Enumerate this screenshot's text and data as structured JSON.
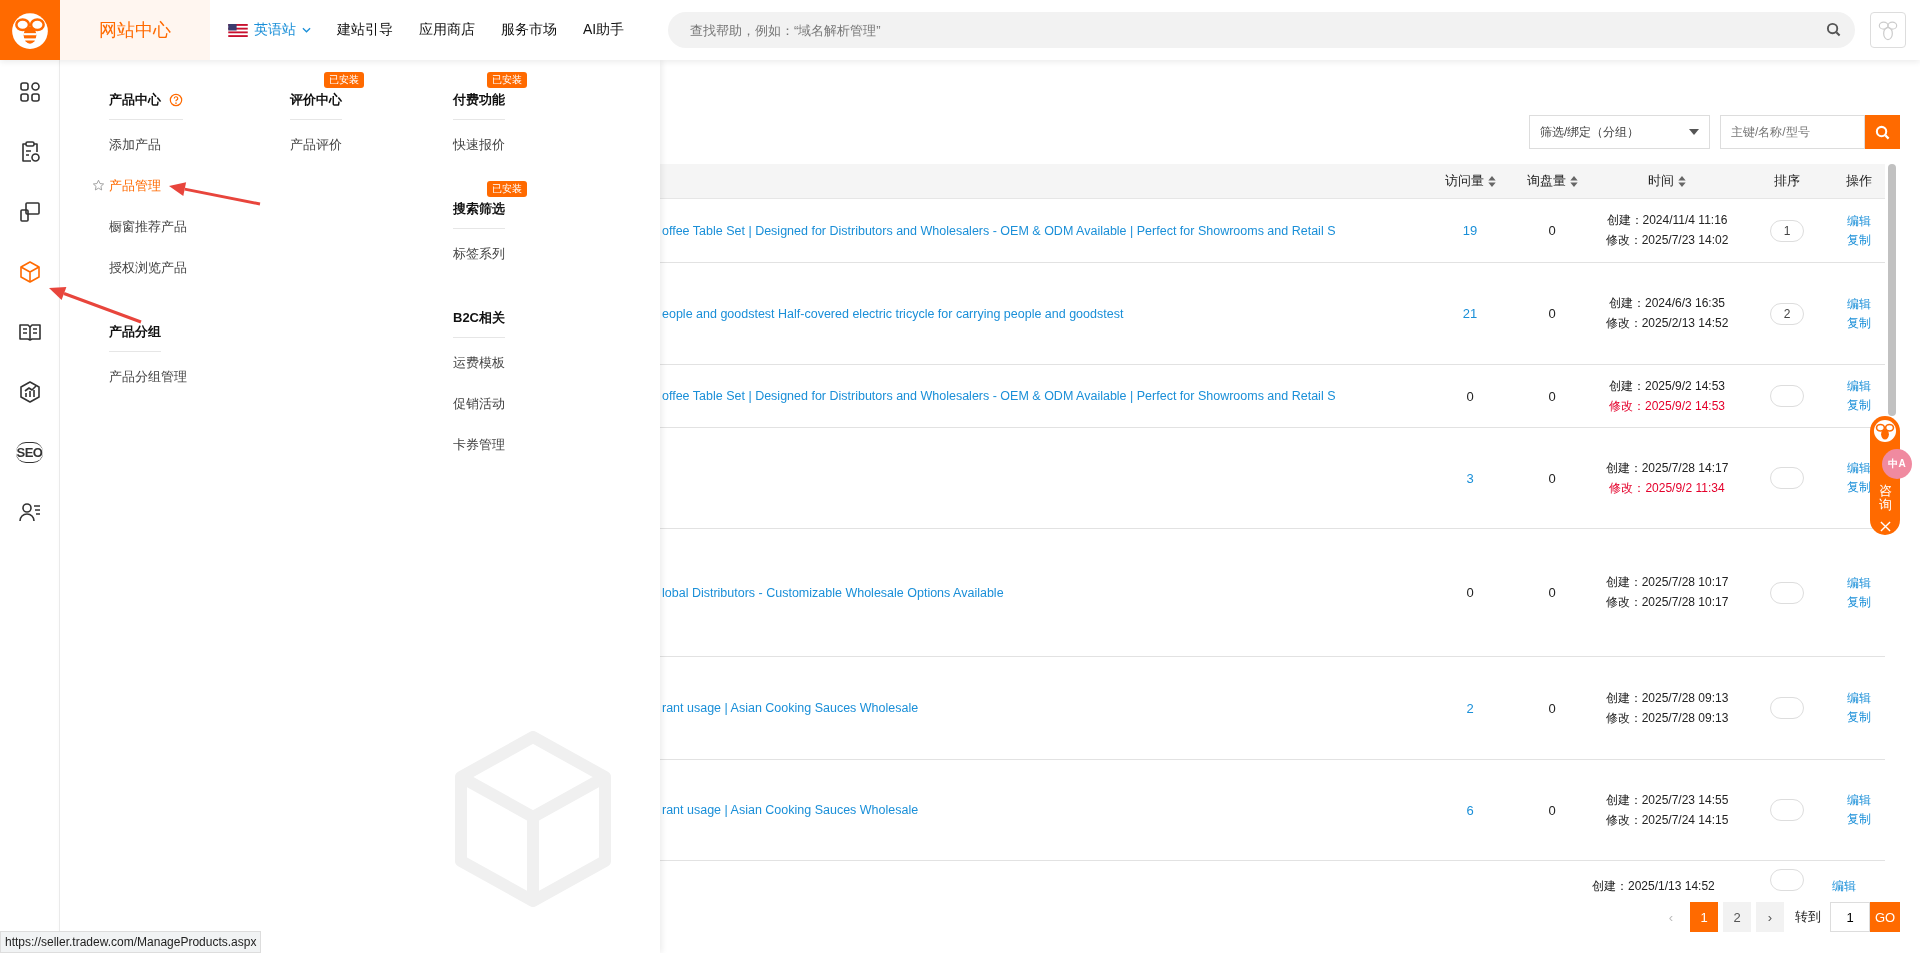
{
  "topbar": {
    "site_title": "网站中心",
    "language": {
      "label": "英语站",
      "selected": true
    },
    "nav": [
      "建站引导",
      "应用商店",
      "服务市场",
      "AI助手"
    ],
    "search": {
      "placeholder": "查找帮助，例如：“域名解析管理”"
    }
  },
  "sidebar": {
    "items": [
      {
        "kind": "grid",
        "selected": false
      },
      {
        "kind": "clipboard",
        "selected": false
      },
      {
        "kind": "devices",
        "selected": false
      },
      {
        "kind": "cube",
        "selected": true
      },
      {
        "kind": "book",
        "selected": false
      },
      {
        "kind": "chart",
        "selected": false
      },
      {
        "kind": "seo",
        "text": "SEO",
        "selected": false
      },
      {
        "kind": "users",
        "selected": false
      }
    ]
  },
  "menu": {
    "columns": [
      [
        {
          "title": "产品中心",
          "help": true,
          "items": [
            {
              "label": "添加产品",
              "selected": false
            },
            {
              "label": "产品管理",
              "selected": true
            },
            {
              "label": "橱窗推荐产品",
              "selected": false
            },
            {
              "label": "授权浏览产品",
              "selected": false
            }
          ]
        },
        {
          "title": "产品分组",
          "items": [
            {
              "label": "产品分组管理",
              "selected": false
            }
          ]
        }
      ],
      [
        {
          "title": "评价中心",
          "badge": "已安装",
          "items": [
            {
              "label": "产品评价",
              "selected": false
            }
          ]
        }
      ],
      [
        {
          "title": "付费功能",
          "badge": "已安装",
          "items": [
            {
              "label": "快速报价",
              "selected": false
            }
          ]
        },
        {
          "title": "搜索筛选",
          "badge": "已安装",
          "items": [
            {
              "label": "标签系列",
              "selected": false
            }
          ]
        },
        {
          "title": "B2C相关",
          "items": [
            {
              "label": "运费模板",
              "selected": false
            },
            {
              "label": "促销活动",
              "selected": false
            },
            {
              "label": "卡券管理",
              "selected": false
            }
          ]
        }
      ]
    ]
  },
  "toolbar": {
    "group_select": {
      "value": "筛选/绑定（分组）"
    },
    "keyword": {
      "placeholder": "主键/名称/型号"
    }
  },
  "table": {
    "columns": [
      {
        "label": "访问量",
        "sortable": true
      },
      {
        "label": "询盘量",
        "sortable": true
      },
      {
        "label": "时间",
        "sortable": true
      },
      {
        "label": "排序",
        "sortable": false
      },
      {
        "label": "操作",
        "sortable": false
      }
    ],
    "rows": [
      {
        "title": "offee Table Set | Designed for Distributors and Wholesalers - OEM & ODM Available | Perfect for Showrooms and Retail S",
        "visits": "19",
        "linked": true,
        "inquiries": "0",
        "created": "创建：2024/11/4 11:16",
        "modified": "修改：2025/7/23 14:02",
        "recent": false,
        "sort": "1",
        "actions": [
          "编辑",
          "复制"
        ]
      },
      {
        "title": "eople and goodstest Half-covered electric tricycle for carrying people and goodstest",
        "visits": "21",
        "linked": true,
        "inquiries": "0",
        "created": "创建：2024/6/3 16:35",
        "modified": "修改：2025/2/13 14:52",
        "recent": false,
        "sort": "2",
        "actions": [
          "编辑",
          "复制"
        ]
      },
      {
        "title": "offee Table Set | Designed for Distributors and Wholesalers - OEM & ODM Available | Perfect for Showrooms and Retail S",
        "visits": "0",
        "linked": false,
        "inquiries": "0",
        "created": "创建：2025/9/2 14:53",
        "modified": "修改：2025/9/2 14:53",
        "recent": true,
        "actions": [
          "编辑",
          "复制"
        ]
      },
      {
        "visits": "3",
        "linked": true,
        "inquiries": "0",
        "created": "创建：2025/7/28 14:17",
        "modified": "修改：2025/9/2 11:34",
        "recent": true,
        "actions": [
          "编辑",
          "复制"
        ]
      },
      {
        "title": "lobal Distributors - Customizable Wholesale Options Available",
        "visits": "0",
        "linked": false,
        "inquiries": "0",
        "created": "创建：2025/7/28 10:17",
        "modified": "修改：2025/7/28 10:17",
        "recent": false,
        "actions": [
          "编辑",
          "复制"
        ]
      },
      {
        "title": "rant usage | Asian Cooking Sauces Wholesale",
        "visits": "2",
        "linked": true,
        "inquiries": "0",
        "created": "创建：2025/7/28 09:13",
        "modified": "修改：2025/7/28 09:13",
        "recent": false,
        "actions": [
          "编辑",
          "复制"
        ]
      },
      {
        "title": "rant usage | Asian Cooking Sauces Wholesale",
        "visits": "6",
        "linked": true,
        "inquiries": "0",
        "created": "创建：2025/7/23 14:55",
        "modified": "修改：2025/7/24 14:15",
        "recent": false,
        "actions": [
          "编辑",
          "复制"
        ]
      },
      {
        "created": "创建：2025/1/13 14:52",
        "actions": [
          "编辑"
        ]
      }
    ]
  },
  "pagination": {
    "prev": "‹",
    "prev_disabled": true,
    "pages": [
      {
        "label": "1",
        "selected": true
      },
      {
        "label": "2",
        "selected": false
      }
    ],
    "next": "›",
    "goto_label": "转到",
    "goto_value": "1",
    "go": "GO"
  },
  "consult_widget": {
    "label": "咨询",
    "translate": "中A"
  },
  "status_bar": "https://seller.tradew.com/ManageProducts.aspx"
}
